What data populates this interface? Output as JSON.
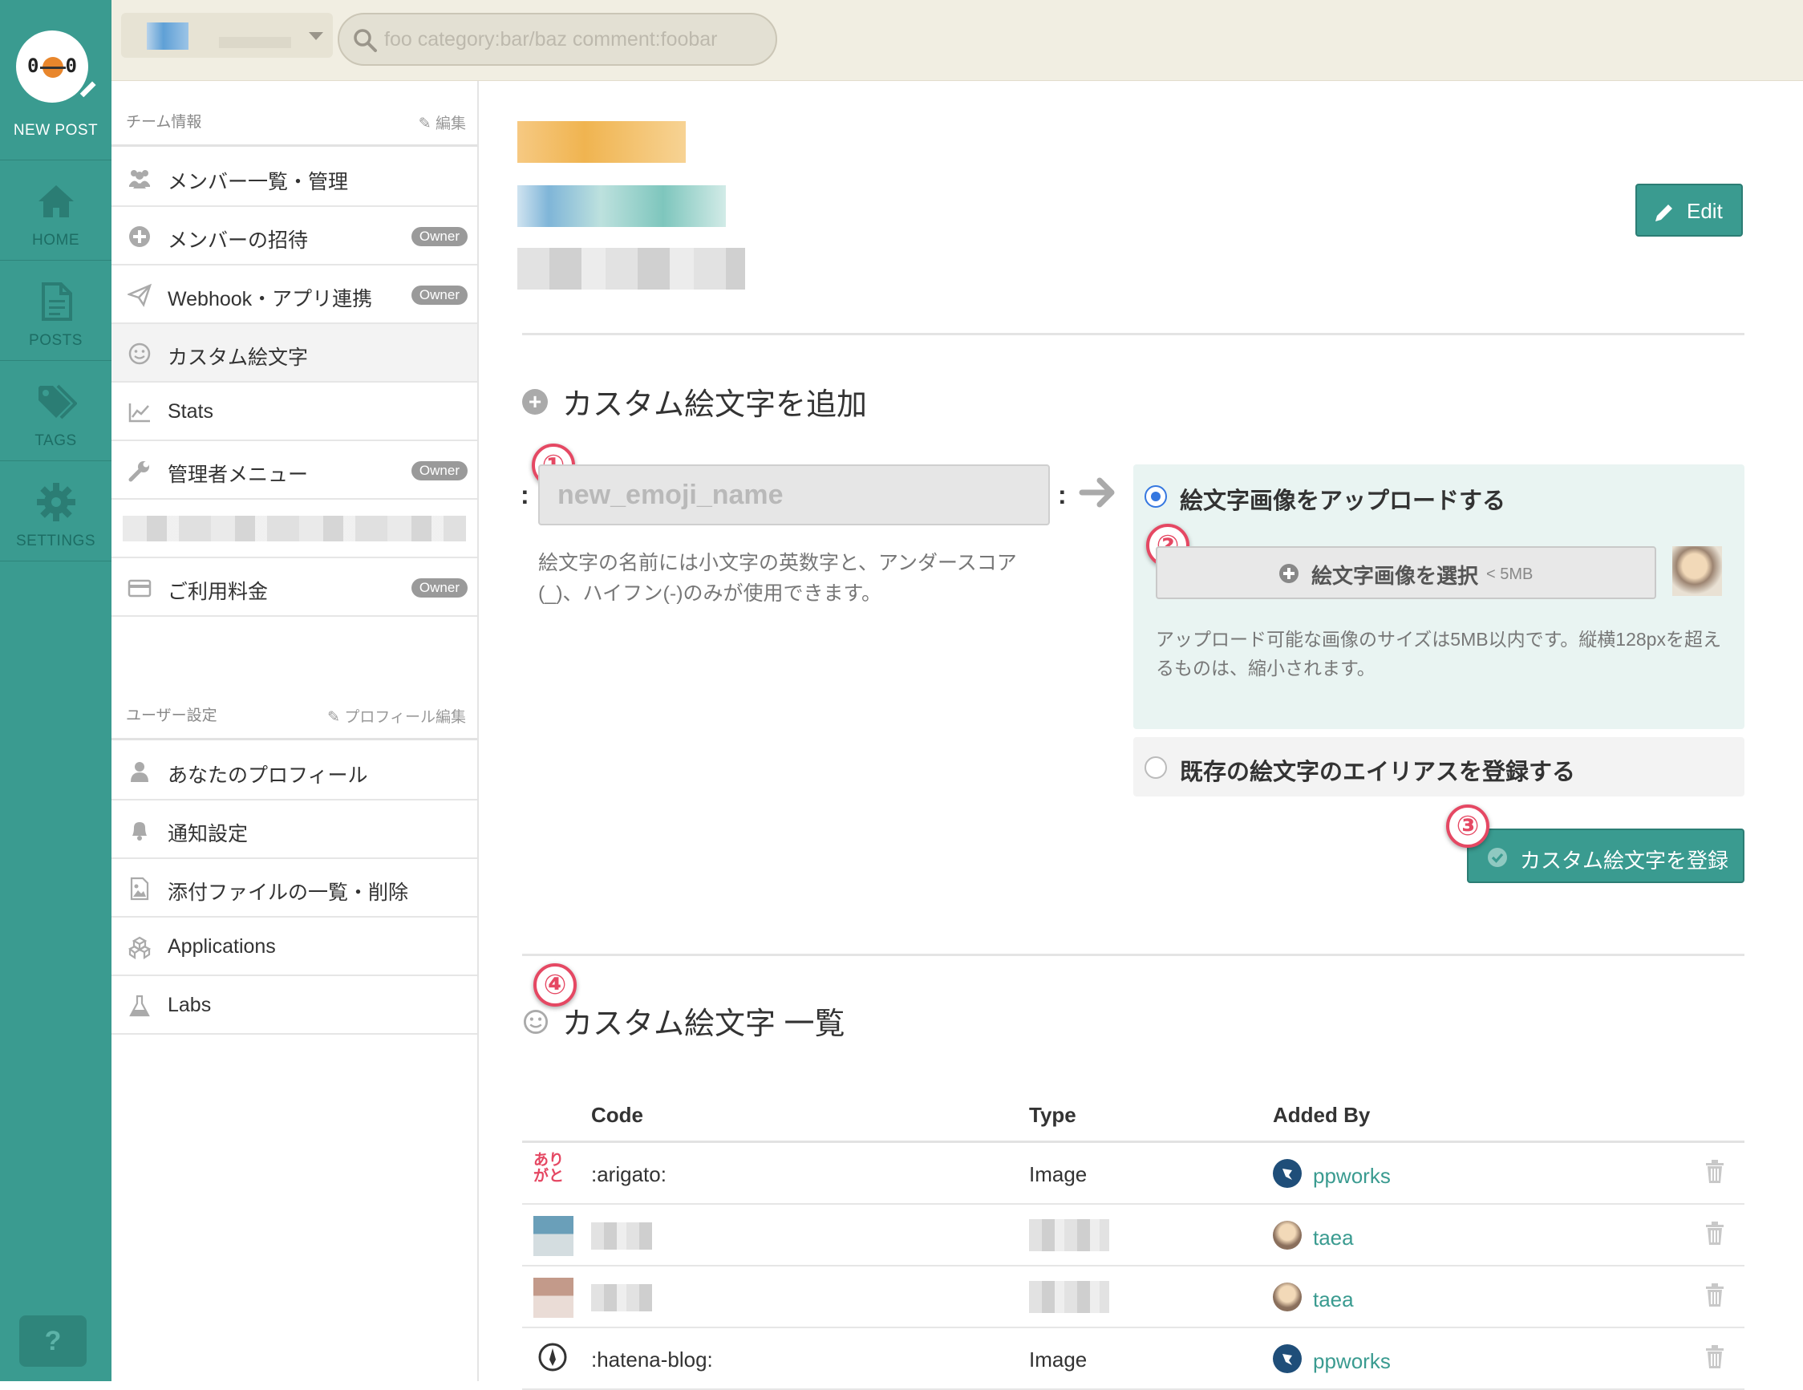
{
  "rail": {
    "new_post": "NEW POST",
    "logo_left": "0",
    "logo_right": "0",
    "items": [
      {
        "label": "HOME",
        "icon": "home-icon"
      },
      {
        "label": "POSTS",
        "icon": "document-icon"
      },
      {
        "label": "TAGS",
        "icon": "tags-icon"
      },
      {
        "label": "SETTINGS",
        "icon": "gear-icon"
      }
    ],
    "help": "?"
  },
  "topbar": {
    "search_placeholder": "foo category:bar/baz comment:foobar"
  },
  "sidebar": {
    "team_section": {
      "title": "チーム情報",
      "edit": "編集"
    },
    "team_items": [
      {
        "label": "メンバー一覧・管理",
        "icon": "members-icon"
      },
      {
        "label": "メンバーの招待",
        "icon": "plus-circle-icon",
        "badge": "Owner"
      },
      {
        "label": "Webhook・アプリ連携",
        "icon": "paper-plane-icon",
        "badge": "Owner"
      },
      {
        "label": "カスタム絵文字",
        "icon": "smile-icon",
        "active": true
      },
      {
        "label": "Stats",
        "icon": "chart-icon"
      },
      {
        "label": "管理者メニュー",
        "icon": "wrench-icon",
        "badge": "Owner"
      },
      {
        "label": "ご利用料金",
        "icon": "credit-card-icon",
        "badge": "Owner"
      }
    ],
    "user_section": {
      "title": "ユーザー設定",
      "edit": "プロフィール編集"
    },
    "user_items": [
      {
        "label": "あなたのプロフィール",
        "icon": "user-icon"
      },
      {
        "label": "通知設定",
        "icon": "bell-icon"
      },
      {
        "label": "添付ファイルの一覧・削除",
        "icon": "image-file-icon"
      },
      {
        "label": "Applications",
        "icon": "cubes-icon"
      },
      {
        "label": "Labs",
        "icon": "flask-icon"
      }
    ]
  },
  "main": {
    "edit_button": "Edit",
    "add_section": {
      "title": "カスタム絵文字を追加",
      "name_placeholder": "new_emoji_name",
      "colon": ":",
      "name_help": "絵文字の名前には小文字の英数字と、アンダースコア(_)、ハイフン(-)のみが使用できます。",
      "upload_option": "絵文字画像をアップロードする",
      "choose_button": "絵文字画像を選択",
      "size_limit": "< 5MB",
      "upload_help": "アップロード可能な画像のサイズは5MB以内です。縦横128pxを超えるものは、縮小されます。",
      "alias_option": "既存の絵文字のエイリアスを登録する",
      "register_button": "カスタム絵文字を登録"
    },
    "markers": [
      "①",
      "②",
      "③",
      "④"
    ],
    "list_section": {
      "title": "カスタム絵文字 一覧",
      "columns": [
        "Code",
        "Type",
        "Added By"
      ],
      "rows": [
        {
          "emoji_text": "ありがと",
          "code": ":arigato:",
          "type": "Image",
          "user": "ppworks",
          "avatar": "ppworks"
        },
        {
          "emoji_text": "",
          "code": "",
          "type": "",
          "user": "taea",
          "avatar": "taea",
          "blurred": true
        },
        {
          "emoji_text": "",
          "code": "",
          "type": "",
          "user": "taea",
          "avatar": "taea",
          "blurred": true
        },
        {
          "emoji_text": "",
          "code": ":hatena-blog:",
          "type": "Image",
          "user": "ppworks",
          "avatar": "ppworks"
        }
      ]
    }
  },
  "colors": {
    "accent": "#3a9b90",
    "marker": "#e54863",
    "owner_badge": "#9a9a9a"
  }
}
